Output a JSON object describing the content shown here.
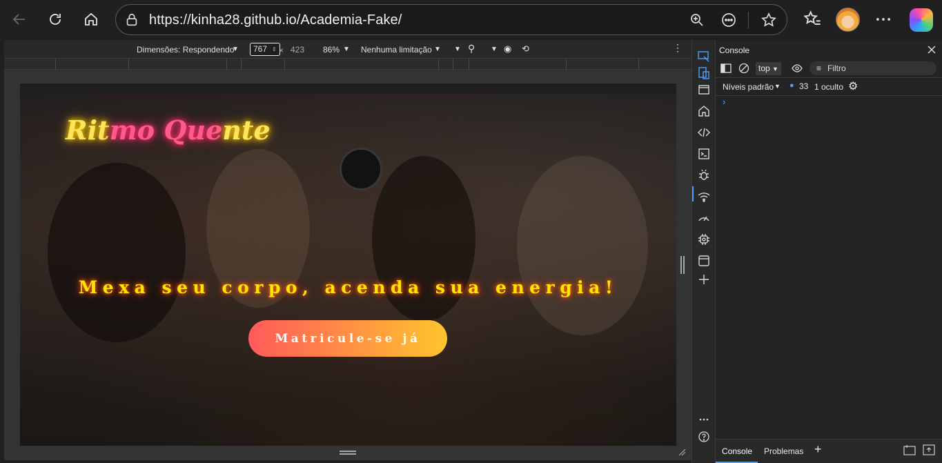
{
  "browser": {
    "url": "https://kinha28.github.io/Academia-Fake/"
  },
  "emulation": {
    "dimensions_label": "Dimensões: Respondendo",
    "width": "767",
    "times": "×",
    "height": "423",
    "zoom": "86%",
    "throttling": "Nenhuma limitação"
  },
  "page": {
    "logo_part1": "Rit",
    "logo_part2": "mo",
    "logo_part3": "Que",
    "logo_part4": "nte",
    "headline": "Mexa seu corpo, acenda sua energia!",
    "cta": "Matricule-se já",
    "colors": {
      "headline": "#ffe600",
      "cta_start": "#ff5a5a",
      "cta_end": "#ffc52e"
    }
  },
  "devtools": {
    "panel_title": "Console",
    "context": "top",
    "filter_placeholder": "Filtro",
    "levels": "Níveis padrão",
    "message_count": "33",
    "hidden_count": "1 oculto",
    "prompt": "›",
    "tabs": [
      "Console",
      "Problemas"
    ],
    "add_tab": "+"
  }
}
